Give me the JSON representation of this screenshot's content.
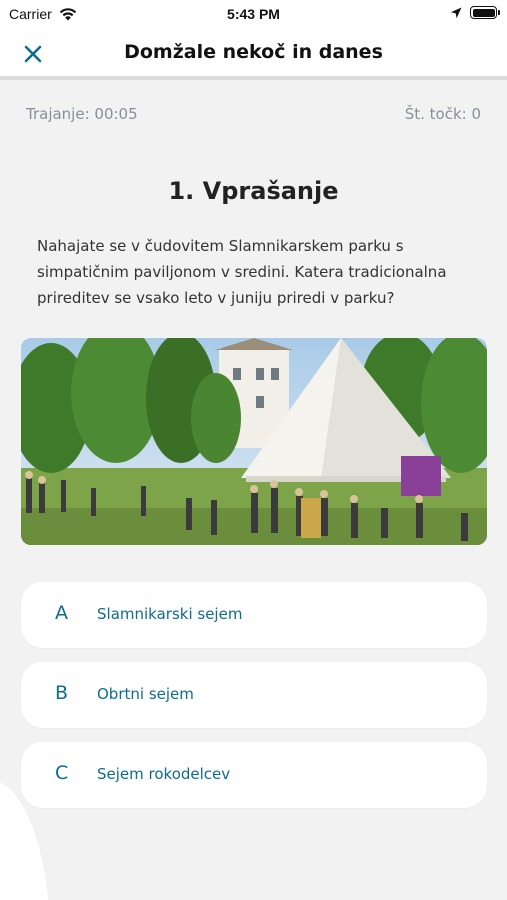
{
  "status_bar": {
    "carrier": "Carrier",
    "time": "5:43 PM",
    "wifi_icon": "wifi-icon",
    "location_icon": "location-arrow-icon",
    "battery_icon": "battery-icon"
  },
  "header": {
    "title": "Domžale nekoč in danes",
    "close_icon": "close-icon",
    "accent_color": "#0e6c8e"
  },
  "info": {
    "duration": "Trajanje: 00:05",
    "points": "Št. točk: 0"
  },
  "question": {
    "title": "1. Vprašanje",
    "text": "Nahajate se v čudovitem Slamnikarskem parku s simpatičnim paviljonom v sredini. Katera tradicionalna prireditev se vsako leto v juniju  priredi v parku?"
  },
  "answers": [
    {
      "letter": "A",
      "text": "Slamnikarski sejem"
    },
    {
      "letter": "B",
      "text": "Obrtni sejem"
    },
    {
      "letter": "C",
      "text": "Sejem rokodelcev"
    }
  ]
}
